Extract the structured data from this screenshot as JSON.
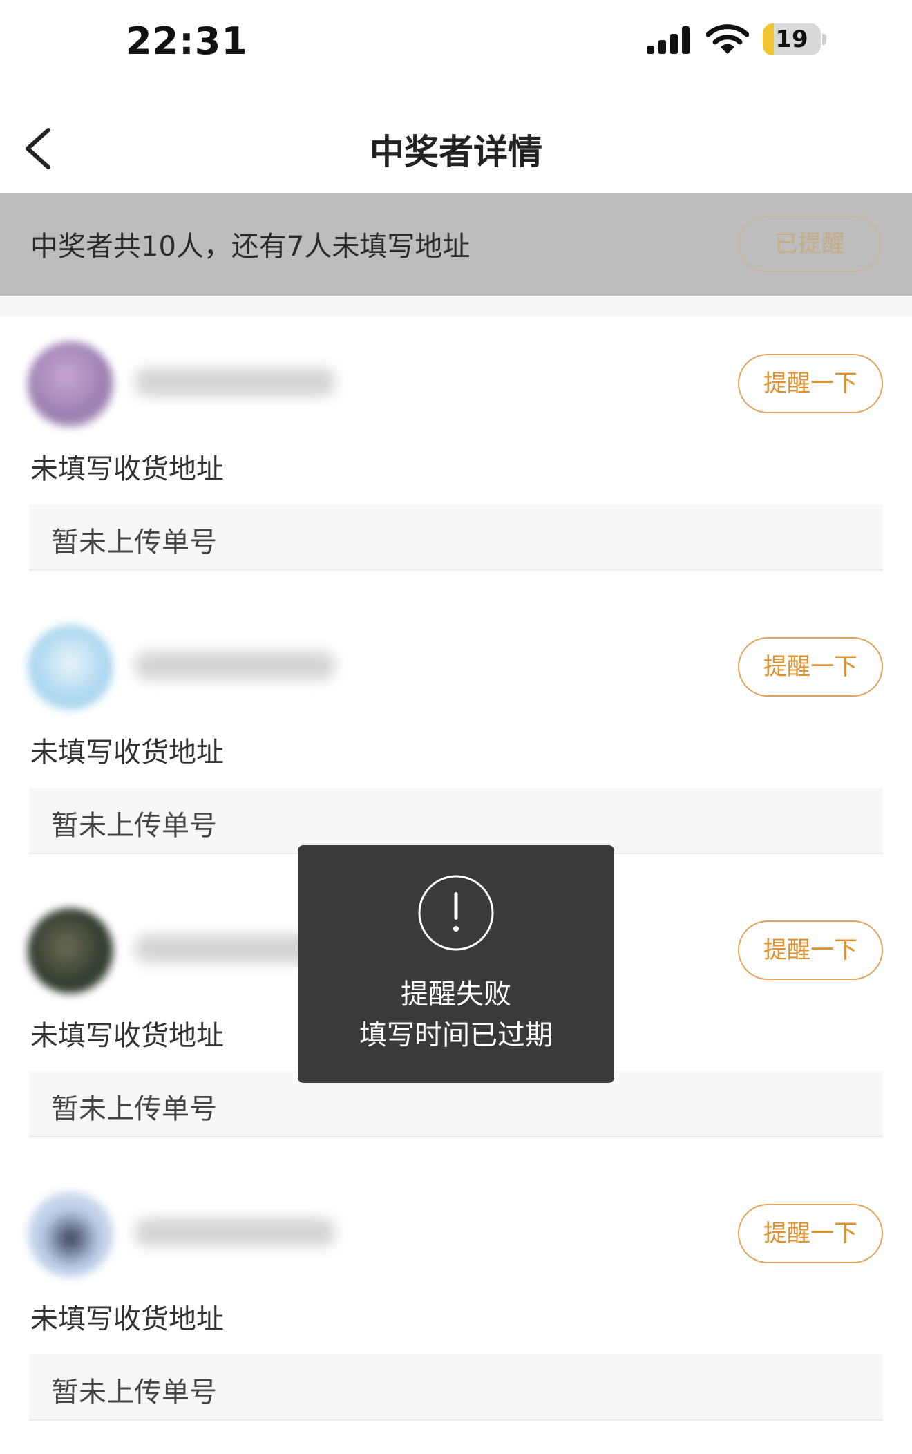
{
  "status_bar": {
    "time": "22:31",
    "battery_level": "19",
    "battery_fraction": 0.19
  },
  "nav": {
    "title": "中奖者详情"
  },
  "summary": {
    "text": "中奖者共10人，还有7人未填写地址",
    "reminded_label": "已提醒"
  },
  "winners": [
    {
      "address_status": "未填写收货地址",
      "tracking": "暂未上传单号",
      "remind_label": "提醒一下"
    },
    {
      "address_status": "未填写收货地址",
      "tracking": "暂未上传单号",
      "remind_label": "提醒一下"
    },
    {
      "address_status": "未填写收货地址",
      "tracking": "暂未上传单号",
      "remind_label": "提醒一下"
    },
    {
      "address_status": "未填写收货地址",
      "tracking": "暂未上传单号",
      "remind_label": "提醒一下"
    }
  ],
  "toast": {
    "icon": "exclamation-circle-icon",
    "title": "提醒失败",
    "message": "填写时间已过期"
  },
  "colors": {
    "accent": "#e0912f",
    "banner": "#bdbdbd",
    "toast_bg": "#3a3a3a"
  }
}
